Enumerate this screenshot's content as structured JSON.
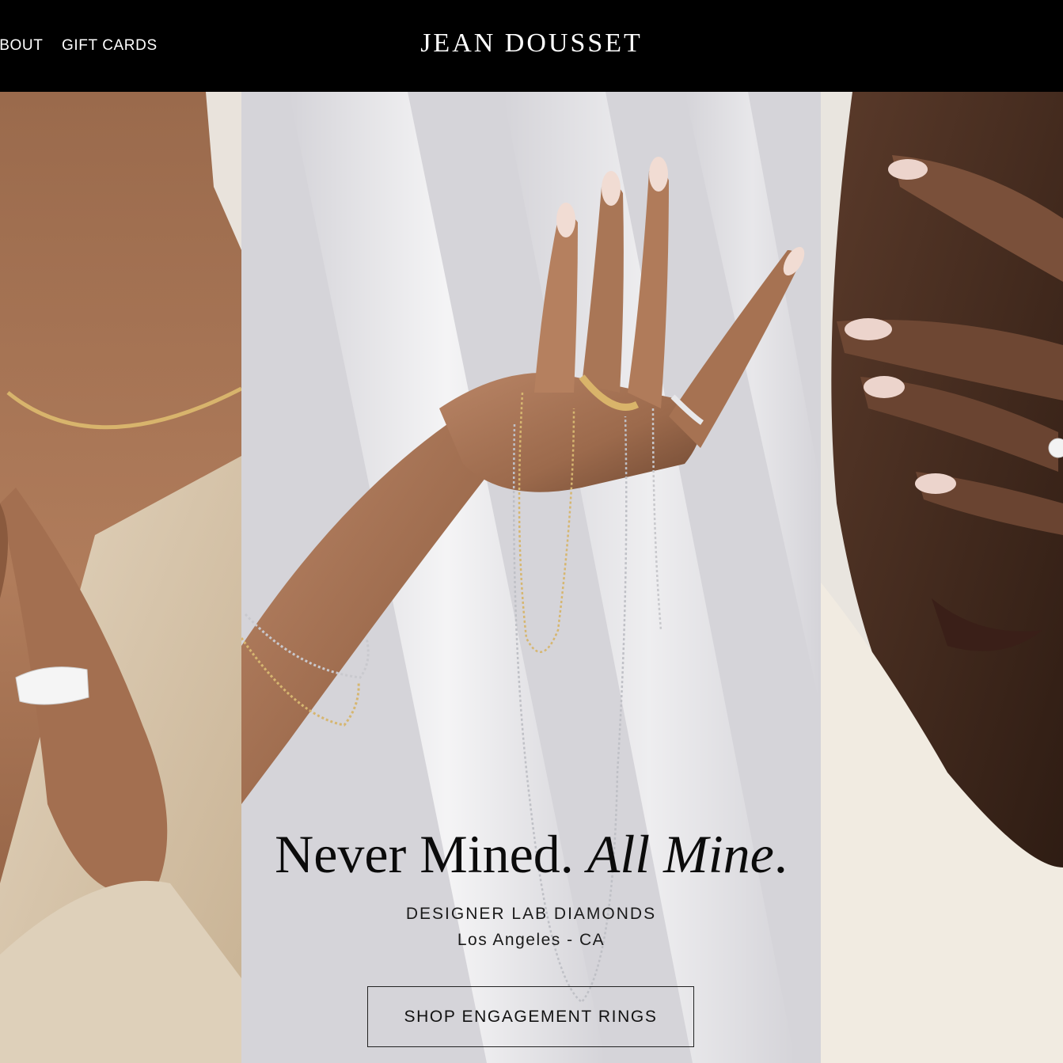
{
  "header": {
    "nav_left": [
      {
        "label": "ABOUT"
      },
      {
        "label": "GIFT CARDS"
      }
    ],
    "logo": "JEAN DOUSSET"
  },
  "hero": {
    "headline_plain": "Never Mined. ",
    "headline_italic": "All Mine",
    "headline_end": ".",
    "subtitle": "DESIGNER LAB DIAMONDS",
    "location": "Los Angeles - CA",
    "cta_label": "SHOP ENGAGEMENT RINGS",
    "panels": [
      {
        "name": "necklace-model-photo"
      },
      {
        "name": "hand-with-chains-photo"
      },
      {
        "name": "face-covered-hand-photo"
      }
    ]
  }
}
